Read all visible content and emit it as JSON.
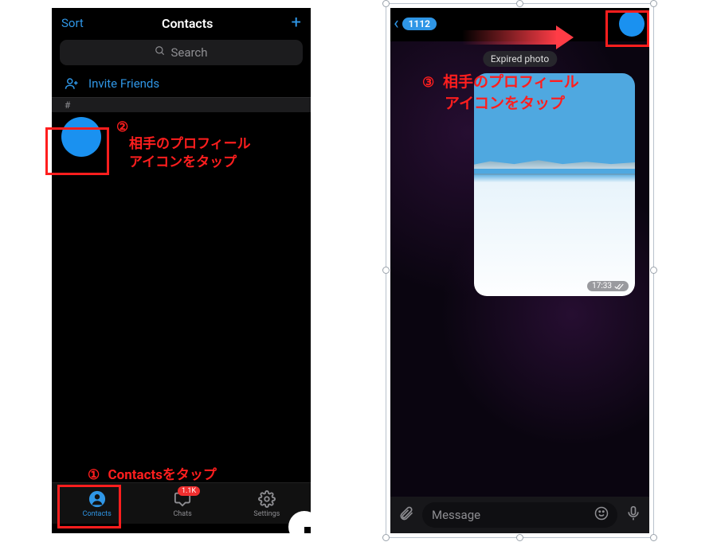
{
  "left": {
    "sort_label": "Sort",
    "title": "Contacts",
    "search_placeholder": "Search",
    "invite_label": "Invite Friends",
    "section_letter": "#",
    "tabs": {
      "contacts": "Contacts",
      "chats": "Chats",
      "chats_badge": "1.1K",
      "settings": "Settings"
    }
  },
  "right": {
    "back_count": "1112",
    "expired_label": "Expired photo",
    "photo_time": "17:33",
    "message_placeholder": "Message"
  },
  "annotations": {
    "step1_num": "①",
    "step1_text": "Contactsをタップ",
    "step2_num": "②",
    "step2_line1": "相手のプロフィール",
    "step2_line2": "アイコンをタップ",
    "step3_num": "③",
    "step3_line1": "相手のプロフィール",
    "step3_line2": "アイコンをタップ"
  }
}
